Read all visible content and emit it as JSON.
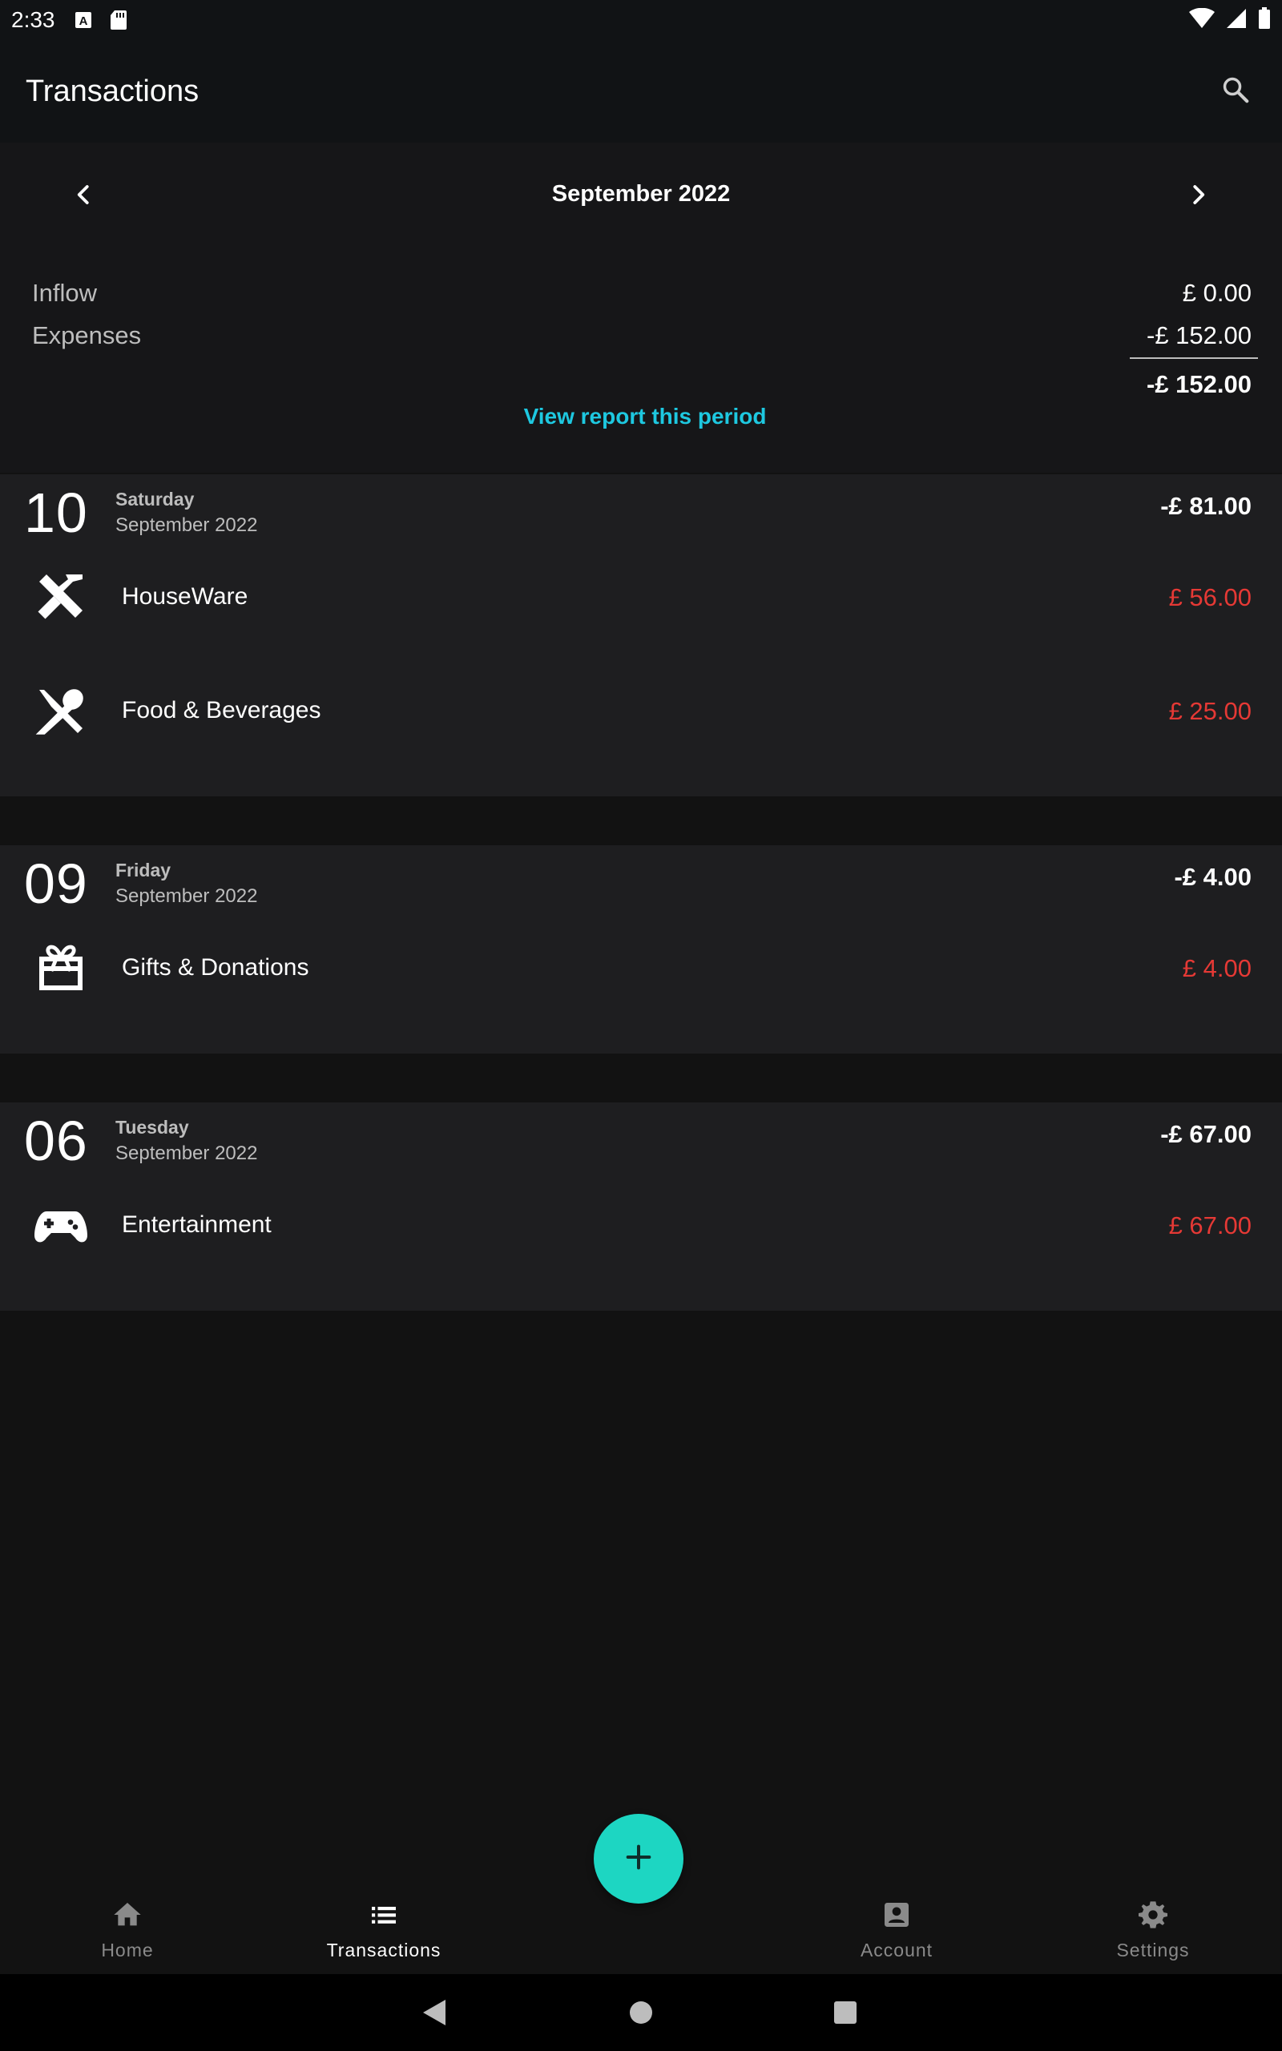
{
  "status_bar": {
    "time": "2:33",
    "icons": [
      "a-badge-icon",
      "sd-card-icon",
      "wifi-icon",
      "signal-icon",
      "battery-icon"
    ]
  },
  "app_bar": {
    "title": "Transactions",
    "search_icon": "search-icon"
  },
  "period": {
    "label": "September 2022",
    "prev_icon": "chevron-left-icon",
    "next_icon": "chevron-right-icon"
  },
  "summary": {
    "inflow_label": "Inflow",
    "inflow_value": "£ 0.00",
    "expenses_label": "Expenses",
    "expenses_value": "-£ 152.00",
    "total": "-£ 152.00",
    "view_report": "View report this period"
  },
  "days": [
    {
      "day": "10",
      "weekday": "Saturday",
      "month": "September 2022",
      "total": "-£ 81.00",
      "transactions": [
        {
          "name": "HouseWare",
          "amount": "£ 56.00",
          "icon": "tools-icon"
        },
        {
          "name": "Food & Beverages",
          "amount": "£ 25.00",
          "icon": "utensils-icon"
        }
      ]
    },
    {
      "day": "09",
      "weekday": "Friday",
      "month": "September 2022",
      "total": "-£ 4.00",
      "transactions": [
        {
          "name": "Gifts & Donations",
          "amount": "£ 4.00",
          "icon": "gift-card-icon"
        }
      ]
    },
    {
      "day": "06",
      "weekday": "Tuesday",
      "month": "September 2022",
      "total": "-£ 67.00",
      "transactions": [
        {
          "name": "Entertainment",
          "amount": "£ 67.00",
          "icon": "gamepad-icon"
        }
      ]
    }
  ],
  "bottom_nav": {
    "items": [
      {
        "label": "Home",
        "icon": "home-icon"
      },
      {
        "label": "Transactions",
        "icon": "list-icon",
        "active": true
      },
      {
        "label": "Account",
        "icon": "account-box-icon"
      },
      {
        "label": "Settings",
        "icon": "gear-icon"
      }
    ]
  },
  "fab": {
    "icon": "plus-icon"
  },
  "colors": {
    "accent": "#1ec8e0",
    "fab": "#1dd6c2",
    "expense": "#e53935",
    "background": "#121212",
    "card": "#1e1e20"
  }
}
